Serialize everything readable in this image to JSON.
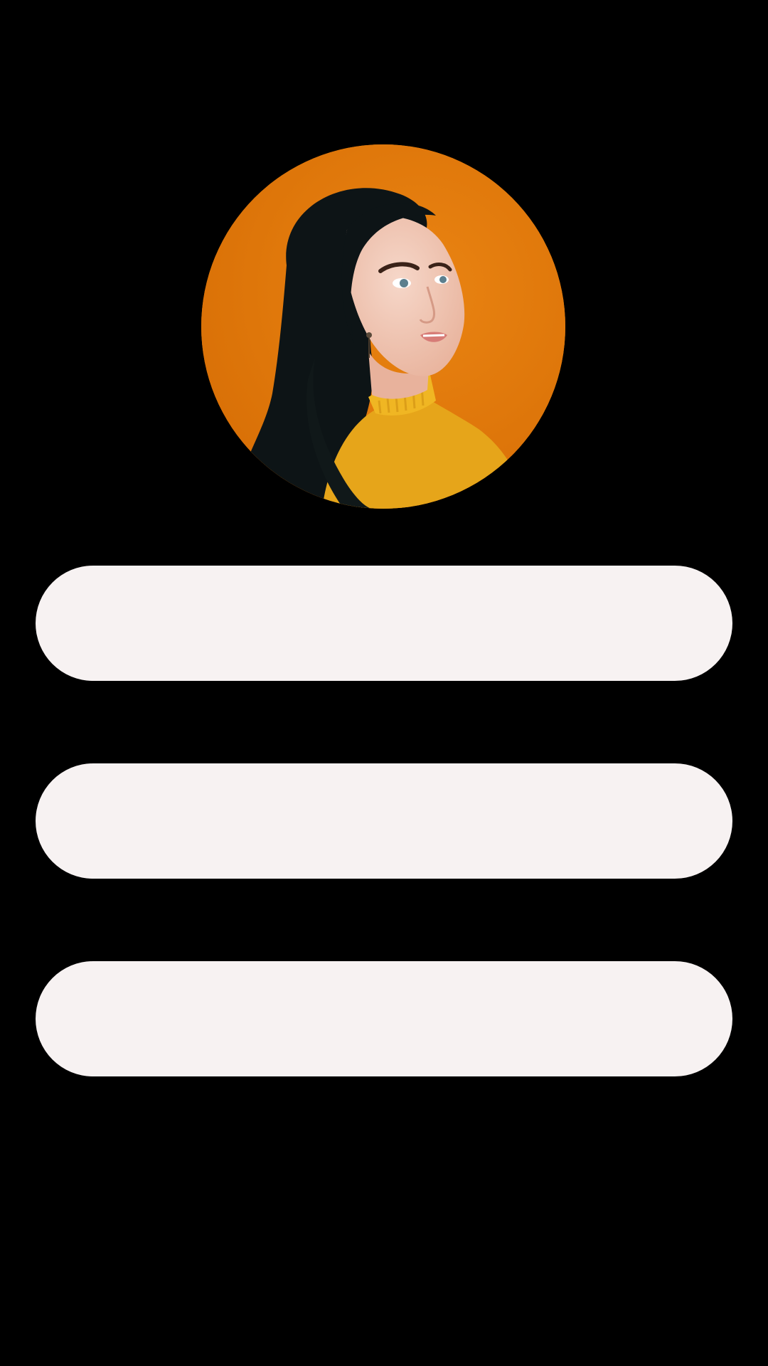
{
  "profile": {
    "avatar_icon": "profile-photo",
    "colors": {
      "background": "#000000",
      "avatar_backdrop": "#e07a0a",
      "button_fill": "#f7f2f2"
    }
  },
  "menu": {
    "buttons": [
      {
        "label": ""
      },
      {
        "label": ""
      },
      {
        "label": ""
      }
    ]
  }
}
